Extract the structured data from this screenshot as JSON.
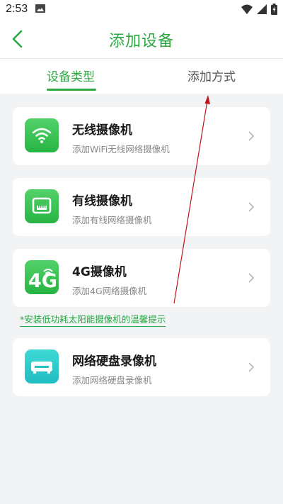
{
  "status": {
    "time": "2:53"
  },
  "header": {
    "title": "添加设备"
  },
  "tabs": [
    {
      "label": "设备类型",
      "active": true
    },
    {
      "label": "添加方式",
      "active": false
    }
  ],
  "devices": [
    {
      "title": "无线摄像机",
      "subtitle": "添加WiFi无线网络摄像机",
      "icon": "wifi-icon"
    },
    {
      "title": "有线摄像机",
      "subtitle": "添加有线网络摄像机",
      "icon": "wired-camera-icon"
    },
    {
      "title": "4G摄像机",
      "subtitle": "添加4G网络摄像机",
      "icon": "4g-icon"
    },
    {
      "title": "网络硬盘录像机",
      "subtitle": "添加网络硬盘录像机",
      "icon": "nvr-icon"
    }
  ],
  "tip": "*安装低功耗太阳能摄像机的温馨提示",
  "icon_4g_label": "4G",
  "colors": {
    "accent": "#2ea843",
    "teal": "#2cc9c9",
    "annotation_arrow": "#c0141b"
  }
}
